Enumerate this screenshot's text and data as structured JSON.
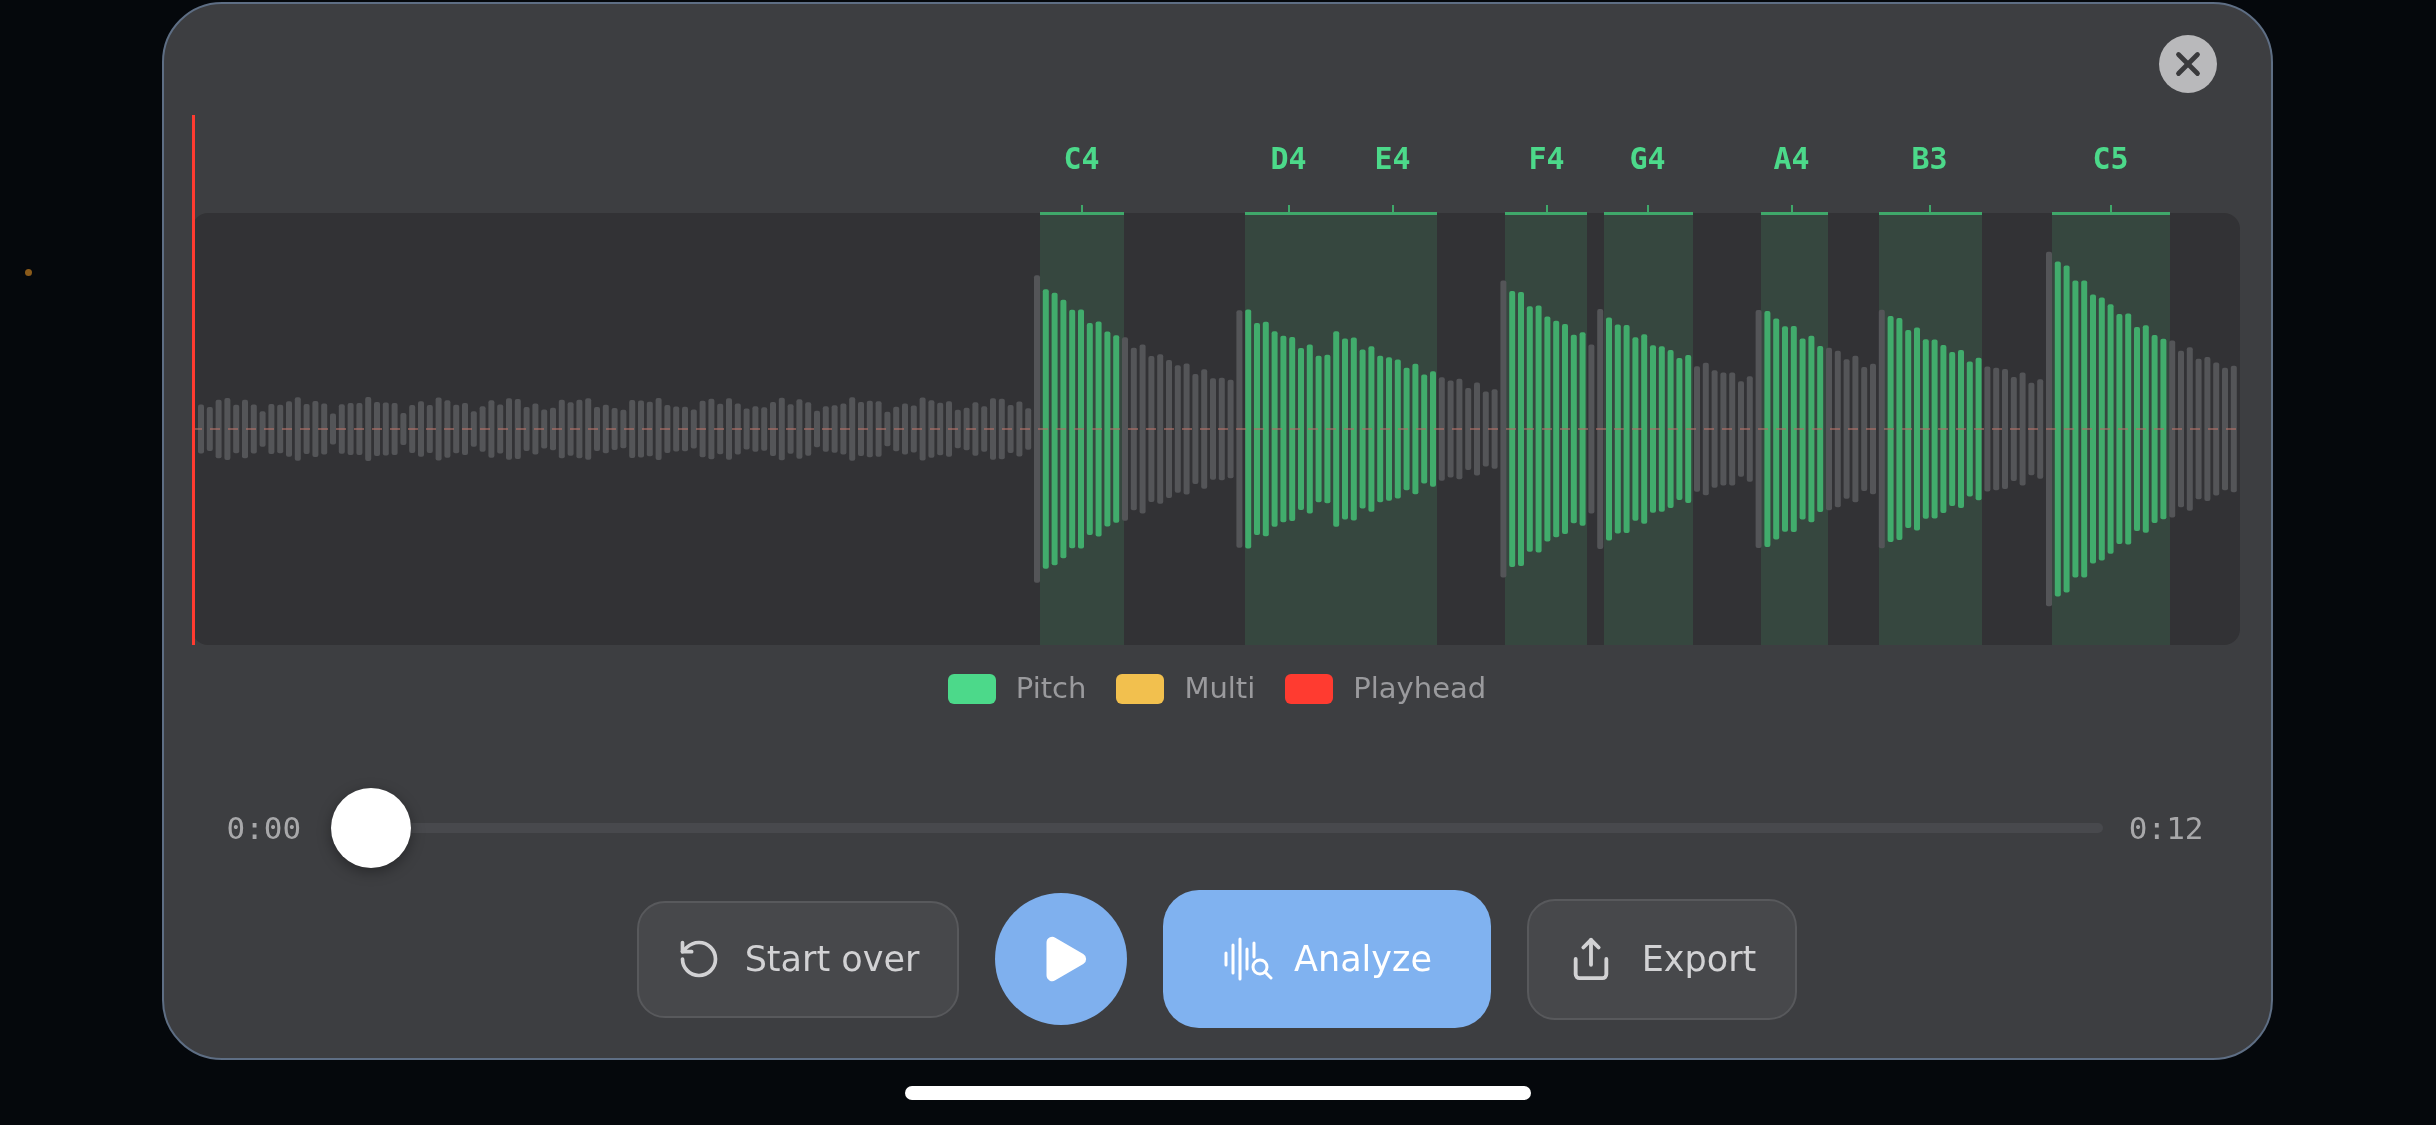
{
  "notes": [
    {
      "label": "C4"
    },
    {
      "label": "D4"
    },
    {
      "label": "E4"
    },
    {
      "label": "F4"
    },
    {
      "label": "G4"
    },
    {
      "label": "A4"
    },
    {
      "label": "B3"
    },
    {
      "label": "C5"
    }
  ],
  "legend": [
    {
      "label": "Pitch",
      "color": "#4cd98a"
    },
    {
      "label": "Multi",
      "color": "#f2c04e"
    },
    {
      "label": "Playhead",
      "color": "#ff3b30"
    }
  ],
  "playback": {
    "elapsed": "0:00",
    "duration": "0:12",
    "level": 0
  },
  "buttons": [
    {
      "kind": "restart",
      "label": "Start over"
    },
    {
      "kind": "play"
    },
    {
      "kind": "analyze",
      "label": "Analyze"
    },
    {
      "kind": "export",
      "label": "Export"
    }
  ]
}
